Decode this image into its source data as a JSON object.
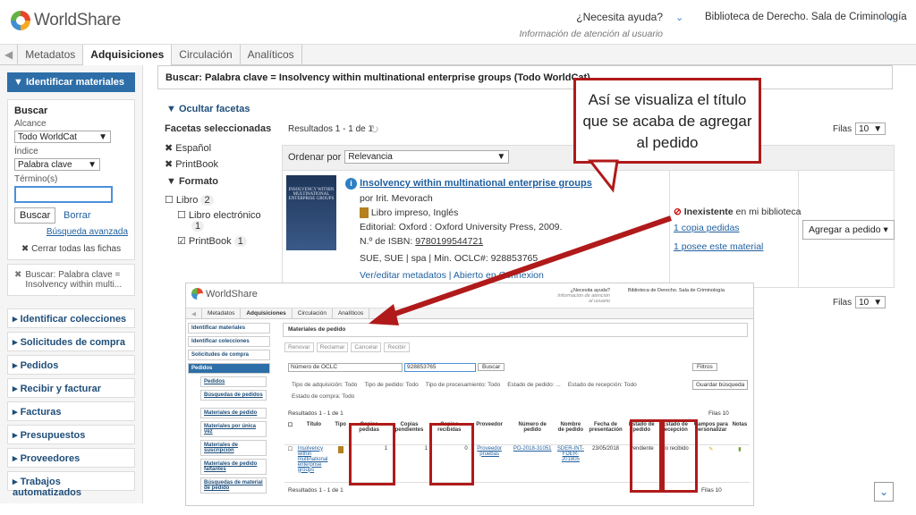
{
  "header": {
    "logo": "WorldShare",
    "help": "¿Necesita ayuda?",
    "help_sub": "Información de atención al usuario",
    "library": "Biblioteca de Derecho. Sala de Criminología"
  },
  "nav": {
    "tabs": [
      "Metadatos",
      "Adquisiciones",
      "Circulación",
      "Analíticos"
    ]
  },
  "sidebar": {
    "head": "Identificar materiales",
    "buscar": "Buscar",
    "alcance": "Alcance",
    "alcance_val": "Todo WorldCat",
    "indice": "Índice",
    "indice_val": "Palabra clave",
    "termino": "Término(s)",
    "btn_buscar": "Buscar",
    "btn_borrar": "Borrar",
    "adv": "Búsqueda avanzada",
    "close_all": "Cerrar todas las fichas",
    "recent": "Buscar: Palabra clave = Insolvency within multi...",
    "items": [
      "Identificar colecciones",
      "Solicitudes de compra",
      "Pedidos",
      "Recibir y facturar",
      "Facturas",
      "Presupuestos",
      "Proveedores",
      "Trabajos automatizados"
    ]
  },
  "main": {
    "title": "Buscar: Palabra clave = Insolvency within multinational enterprise groups (Todo WorldCat)",
    "hide_facets": "Ocultar facetas",
    "facets_sel": "Facetas seleccionadas",
    "facet_es": "Español",
    "facet_pb": "PrintBook",
    "formato": "Formato",
    "libro": "Libro",
    "libro_n": "2",
    "ebook": "Libro electrónico",
    "ebook_n": "1",
    "printbook": "PrintBook",
    "printbook_n": "1",
    "results": "Resultados 1 - 1 de 1",
    "filas": "Filas",
    "filas_val": "10",
    "ordenar": "Ordenar por",
    "ordenar_val": "Relevancia",
    "book_title": "Insolvency within multinational enterprise groups",
    "author": "por Irit. Mevorach",
    "format": "Libro impreso, Inglés",
    "publisher": "Editorial: Oxford : Oxford University Press, 2009.",
    "isbn_label": "N.º de ISBN:",
    "isbn": "9780199544721",
    "codes": "SUE, SUE | spa | Min. OCLC#: 928853765",
    "links": "Ver/editar metadatos | Abierto en Connexion",
    "holding": "Inexistente",
    "holding_sub": "en mi biblioteca",
    "copies": "1 copia pedidas",
    "owns": "1 posee este material",
    "add_order": "Agregar a pedido",
    "cover": "INSOLVENCY WITHIN MULTINATIONAL ENTERPRISE GROUPS"
  },
  "callout": "Así se visualiza el título que se acaba de agregar al pedido",
  "inset": {
    "title": "Materiales de pedido",
    "toolbar": [
      "Renovar",
      "Reclamar",
      "Cancelar",
      "Recibir"
    ],
    "field": "Número de OCLC",
    "value": "928853765",
    "buscar": "Buscar",
    "filtros": "Filtros",
    "f1": "Tipo de adquisición: Todo",
    "f2": "Tipo de pedido: Todo",
    "f3": "Tipo de procesamiento: Todo",
    "f4": "Estado de pedido: ...",
    "f5": "Estado de recepción: Todo",
    "f6": "Estado de compra: Todo",
    "guardar": "Guardar búsqueda",
    "results": "Resultados 1 - 1 de 1",
    "filas": "Filas 10",
    "side": [
      "Identificar materiales",
      "Identificar colecciones",
      "Solicitudes de compra",
      "Pedidos",
      "Pedidos",
      "Búsquedas de pedidos",
      "Materiales de pedido",
      "Materiales por única vez",
      "Materiales de suscripción",
      "Materiales de pedido faltantes",
      "Búsquedas de material de pedido"
    ],
    "cols": [
      "Título",
      "Tipo",
      "Copias pedidas",
      "Copias pendientes",
      "Copias recibidas",
      "Proveedor",
      "Número de pedido",
      "Nombre de pedido",
      "Fecha de presentación",
      "Estado de pedido",
      "Estado de recepción",
      "Campos para personalizar",
      "Notas"
    ],
    "row": [
      "Insolvency within multinational enterprise groups",
      "",
      "1",
      "1",
      "0",
      "Proveedor pruebas",
      "PO-2018-31051",
      "SDER-INT-FDER-201805",
      "23/05/2018",
      "Pendiente",
      "No recibido",
      "",
      ""
    ]
  }
}
